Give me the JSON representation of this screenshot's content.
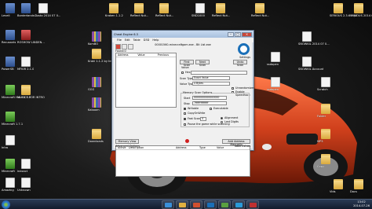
{
  "desktop": {
    "icons": [
      {
        "label": "Leveli",
        "kind": "app"
      },
      {
        "label": "Borderlands 2",
        "kind": "app"
      },
      {
        "label": "Gusto 2014 07 0...",
        "kind": "file"
      },
      {
        "label": "Kraken 1.1.2",
        "kind": "folder"
      },
      {
        "label": "Reflect Nut...",
        "kind": "folder"
      },
      {
        "label": "Reflect Nut...",
        "kind": "folder"
      },
      {
        "label": "SND1000",
        "kind": "file"
      },
      {
        "label": "Reflect Nut...",
        "kind": "folder"
      },
      {
        "label": "Reflect Nut...",
        "kind": "folder"
      },
      {
        "label": "SERIOUS 2.3.6 mp3",
        "kind": "folder"
      },
      {
        "label": "SERIOUS 2014 07 0...",
        "kind": "folder"
      },
      {
        "label": "Recusants",
        "kind": "app"
      },
      {
        "label": "ROSHOW LINDEN...",
        "kind": "red"
      },
      {
        "label": "KomBO",
        "kind": "winrar"
      },
      {
        "label": "GGG",
        "kind": "winrar"
      },
      {
        "label": "Kraki 1.1.2 by tirosh",
        "kind": "folder"
      },
      {
        "label": "PowerSB",
        "kind": "app"
      },
      {
        "label": "MFKIR 2.1.0",
        "kind": "file"
      },
      {
        "label": "Minecraft Hack 1.7.5",
        "kind": "green"
      },
      {
        "label": "MUSICS FOR INTRO",
        "kind": "folder"
      },
      {
        "label": "Minecraft 1.7.1",
        "kind": "green"
      },
      {
        "label": "Kaboom",
        "kind": "winrar"
      },
      {
        "label": "Intro",
        "kind": "file"
      },
      {
        "label": "Minecraft",
        "kind": "green"
      },
      {
        "label": "inexact",
        "kind": "file"
      },
      {
        "label": "Downloads",
        "kind": "folder"
      },
      {
        "label": "Amazing",
        "kind": "file"
      },
      {
        "label": "Unknown",
        "kind": "file"
      },
      {
        "label": "SNOWKIL 2014 07 0...",
        "kind": "file"
      },
      {
        "label": "SNOWKIL Account",
        "kind": "file"
      },
      {
        "label": "ssdopen",
        "kind": "file"
      },
      {
        "label": "ssdopen",
        "kind": "file"
      },
      {
        "label": "Scratch",
        "kind": "file"
      },
      {
        "label": "Folder",
        "kind": "folder"
      },
      {
        "label": "MP3",
        "kind": "folder"
      },
      {
        "label": "Copy",
        "kind": "folder"
      },
      {
        "label": "Vids",
        "kind": "folder"
      },
      {
        "label": "Docs",
        "kind": "folder"
      }
    ]
  },
  "window": {
    "title": "Cheat Engine 6.3",
    "menu": [
      "File",
      "Edit",
      "Table",
      "D3D",
      "Help"
    ],
    "process": "00001560-minecraftgam.exe - Bit List.exe",
    "found_label": "Found:0",
    "list_headers": [
      "Address",
      "Value",
      "Previous"
    ],
    "first_scan": "First Scan",
    "next_scan": "Next Scan",
    "undo_scan": "Undo Scan",
    "settings_label": "Settings",
    "value_label": "Value:",
    "hex_label": "Hex",
    "scan_type_label": "Scan Type",
    "scan_type_value": "Exact Value",
    "value_type_label": "Value Type",
    "value_type_value": "4 Bytes",
    "mem_scan_label": "Memory Scan Options",
    "start_label": "Start",
    "start_value": "0000000000000000",
    "stop_label": "Stop",
    "stop_value": "7fffffffffffffff",
    "writable": "Writable",
    "executable": "Executable",
    "copy_on_write": "CopyOnWrite",
    "fast_scan": "Fast Scan",
    "fast_scan_value": "4",
    "alignment": "Alignment",
    "last_digits": "Last Digits",
    "pause_game": "Pause the game while scanning",
    "unrandomizer": "Unrandomizer",
    "speedhack": "Enable Speedhack",
    "memory_view": "Memory View",
    "add_address": "Add Address Manually",
    "table_headers": [
      "Active",
      "Description",
      "Address",
      "Type",
      "Value"
    ],
    "advanced": "Advanced Options",
    "table_extras": "Table Extras"
  },
  "taskbar": {
    "time": "13:02",
    "date": "2014-07-26",
    "apps": [
      "Chrome",
      "Explorer",
      "Media",
      "Cheat Engine",
      "Minecraft",
      "Skype",
      "Recorder"
    ]
  },
  "colors": {
    "ce_logo": "#1a6fb8",
    "titlebar": "#c6d8ee",
    "taskbar": "#121b2c"
  }
}
